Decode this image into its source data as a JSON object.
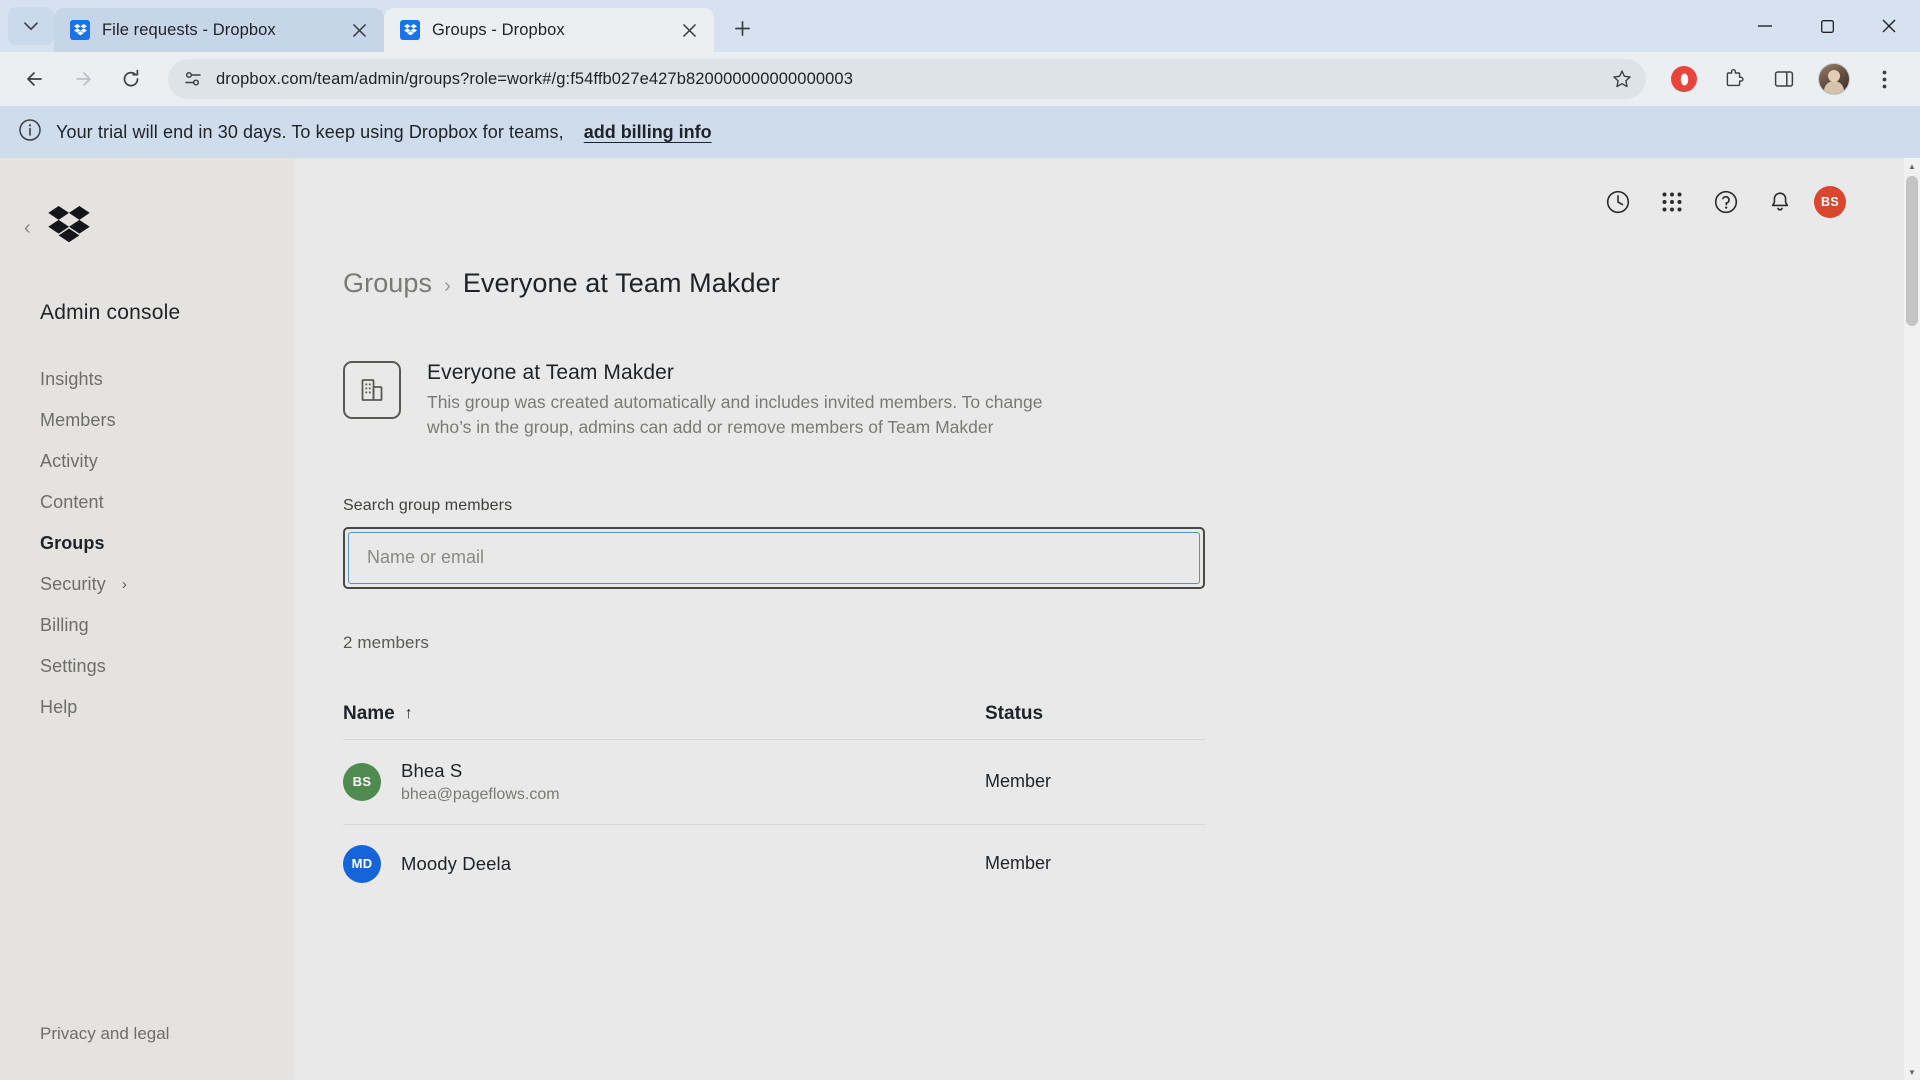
{
  "browser": {
    "tabs": [
      {
        "title": "File requests - Dropbox",
        "active": false,
        "favicon": "dropbox-icon"
      },
      {
        "title": "Groups - Dropbox",
        "active": true,
        "favicon": "dropbox-icon"
      }
    ],
    "new_tab_label": "+",
    "url": "dropbox.com/team/admin/groups?role=work#/g:f54ffb027e427b820000000000000003",
    "window_controls": {
      "minimize": "–",
      "maximize": "❐",
      "close": "✕"
    }
  },
  "trial": {
    "message": "Your trial will end in 30 days. To keep using Dropbox for teams,",
    "link": "add billing info",
    "icon": "info-icon"
  },
  "sidebar": {
    "title": "Admin console",
    "collapse_icon": "chevron-left-icon",
    "logo": "dropbox-logo",
    "items": [
      {
        "label": "Insights",
        "active": false
      },
      {
        "label": "Members",
        "active": false
      },
      {
        "label": "Activity",
        "active": false
      },
      {
        "label": "Content",
        "active": false
      },
      {
        "label": "Groups",
        "active": true
      },
      {
        "label": "Security",
        "active": false,
        "chevron": "›"
      },
      {
        "label": "Billing",
        "active": false
      },
      {
        "label": "Settings",
        "active": false
      },
      {
        "label": "Help",
        "active": false
      }
    ],
    "footer": "Privacy and legal"
  },
  "topbar": {
    "icons": [
      "history-clock-icon",
      "apps-grid-icon",
      "help-circle-icon",
      "notifications-bell-icon"
    ],
    "avatar_initials": "BS",
    "avatar_color": "#d9472f"
  },
  "breadcrumb": {
    "parent": "Groups",
    "separator": "›",
    "current": "Everyone at Team Makder"
  },
  "group": {
    "icon": "company-building-icon",
    "name": "Everyone at Team Makder",
    "description": "This group was created automatically and includes invited members. To change who’s in the group, admins can add or remove members of Team Makder"
  },
  "search": {
    "label": "Search group members",
    "placeholder": "Name or email",
    "value": ""
  },
  "members": {
    "count_label": "2 members",
    "columns": {
      "name": "Name",
      "sort_icon": "↑",
      "status": "Status"
    },
    "rows": [
      {
        "initials": "BS",
        "color": "#4f8a4f",
        "name": "Bhea S",
        "email": "bhea@pageflows.com",
        "status": "Member"
      },
      {
        "initials": "MD",
        "color": "#1565d8",
        "name": "Moody Deela",
        "email": "",
        "status": "Member"
      }
    ]
  }
}
